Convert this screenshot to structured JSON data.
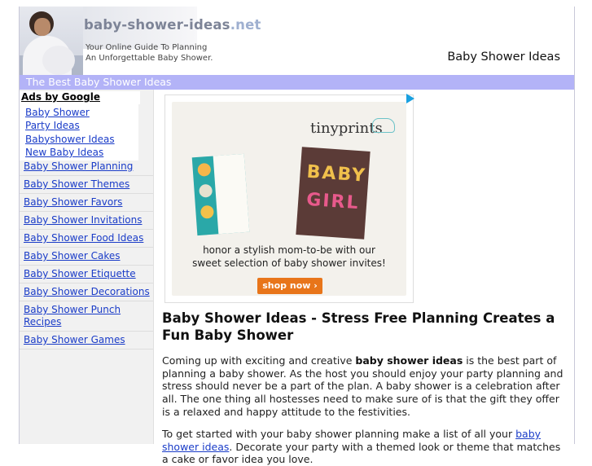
{
  "header": {
    "logo_main": "baby-shower-ideas",
    "logo_tld": ".net",
    "tagline_1": "Your Online Guide To Planning",
    "tagline_2": "An Unforgettable Baby Shower.",
    "site_title": "Baby Shower Ideas",
    "banner": "The Best Baby Shower Ideas"
  },
  "sidebar": {
    "ads_title": "Ads by Google",
    "ads": [
      "Baby Shower",
      "Party Ideas",
      "Babyshower Ideas",
      "New Baby Ideas"
    ],
    "nav": [
      "Baby Shower Planning",
      "Baby Shower Themes",
      "Baby Shower Favors",
      "Baby Shower Invitations",
      "Baby Shower Food Ideas",
      "Baby Shower Cakes",
      "Baby Shower Etiquette",
      "Baby Shower Decorations",
      "Baby Shower Punch Recipes",
      "Baby Shower Games"
    ]
  },
  "ad": {
    "brand": "tinyprints",
    "card_line1": "BABY",
    "card_line2": "GIRL",
    "copy_1": "honor a stylish mom-to-be with our",
    "copy_2": "sweet selection of baby shower invites!",
    "cta": "shop now ›"
  },
  "article": {
    "headline": "Baby Shower Ideas - Stress Free Planning Creates a Fun Baby Shower",
    "p1_a": "Coming up with exciting and creative ",
    "p1_bold": "baby shower ideas",
    "p1_b": " is the best part of planning a baby shower. As the host you should enjoy your party planning and stress should never be a part of the plan. A baby shower is a celebration after all. The one thing all hostesses need to make sure of is that the gift they offer is a relaxed and happy attitude to the festivities.",
    "p2_a": "To get started with your baby shower planning make a list of all your ",
    "p2_link": "baby shower ideas",
    "p2_b": ". Decorate your party with a themed look or theme that matches a cake or favor idea you love."
  }
}
